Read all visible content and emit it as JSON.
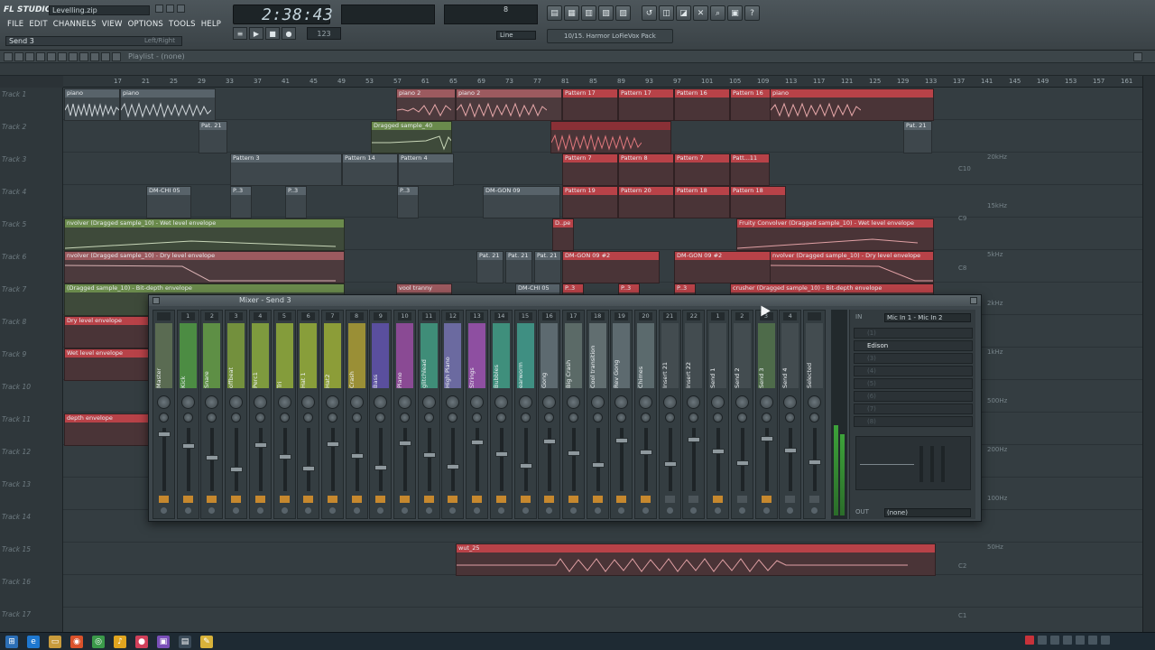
{
  "app": {
    "logo": "FL STUDIO",
    "filename": "Levelling.zip",
    "hint": "Send 3",
    "hint_right": "Left/Right"
  },
  "menu": [
    "FILE",
    "EDIT",
    "CHANNELS",
    "VIEW",
    "OPTIONS",
    "TOOLS",
    "HELP"
  ],
  "transport": {
    "time": "2:38:43",
    "play_icon": "play-icon",
    "stop_icon": "stop-icon",
    "record_icon": "record-icon",
    "cpu_value": "8",
    "line_mode": "Line"
  },
  "browser_preset": "10/15. Harmor LoFieVox Pack",
  "playlist": {
    "title": "Playlist - (none)",
    "ruler": [
      "17",
      "21",
      "25",
      "29",
      "33",
      "37",
      "41",
      "45",
      "49",
      "53",
      "57",
      "61",
      "65",
      "69",
      "73",
      "77",
      "81",
      "85",
      "89",
      "93",
      "97",
      "101",
      "105",
      "109",
      "113",
      "117",
      "121",
      "125",
      "129",
      "133",
      "137",
      "141",
      "145",
      "149",
      "153",
      "157",
      "161",
      "165"
    ],
    "tracks": [
      "Track 1",
      "Track 2",
      "Track 3",
      "Track 4",
      "Track 5",
      "Track 6",
      "Track 7",
      "Track 8",
      "Track 9",
      "Track 10",
      "Track 11",
      "Track 12",
      "Track 13",
      "Track 14",
      "Track 15",
      "Track 16",
      "Track 17"
    ],
    "piano_labels": [
      "C10",
      "C9",
      "C8",
      "C7",
      "C6",
      "C5",
      "C4",
      "C3",
      "C2",
      "C1"
    ],
    "freq_labels": [
      "20kHz",
      "15kHz",
      "5kHz",
      "2kHz",
      "1kHz",
      "500Hz",
      "200Hz",
      "100Hz",
      "50Hz"
    ],
    "clips": {
      "t1a": "piano",
      "t1b": "piano",
      "t1c": "piano 2",
      "t1d": "piano 2",
      "t1e": "Pattern 17",
      "t1f": "Pattern 17",
      "t1g": "Pattern 16",
      "t1h": "Pattern 16",
      "t1i": "piano",
      "t2a": "Pat. 21",
      "t2b": "Dragged sample_40",
      "t2c": "Pat. 21",
      "t3a": "Pattern 3",
      "t3b": "Pattern 14",
      "t3c": "Pattern 4",
      "t3d": "Pattern 7",
      "t3e": "Pattern 8",
      "t3f": "Pattern 7",
      "t3g": "Patt...11",
      "t4a": "DM-CHI 05",
      "t4b": "P..3",
      "t4c": "P..3",
      "t4d": "P..3",
      "t4e": "DM-GON 09",
      "t4f": "Pattern 19",
      "t4g": "Pattern 20",
      "t4h": "Pattern 18",
      "t4i": "Pattern 18",
      "t5a": "nvolver (Dragged sample_10) - Wet level envelope",
      "t5b": "D..pe",
      "t5c": "Fruity Convolver (Dragged sample_10) - Wet level envelope",
      "t6a": "nvolver (Dragged sample_10) - Dry level envelope",
      "t6b": "Pat. 21",
      "t6c": "Pat. 21",
      "t6d": "Pat. 21",
      "t6e": "DM-GON 09 #2",
      "t6f": "DM-GON 09 #2",
      "t6g": "nvolver (Dragged sample_10) - Dry level envelope",
      "t7a": "(Dragged sample_10) - Bit-depth envelope",
      "t7b": "vool tranny",
      "t7c": "DM-CHI 05",
      "t7d": "P..3",
      "t7e": "P..3",
      "t7f": "P..3",
      "t7g": "crusher (Dragged sample_10) - Bit-depth envelope",
      "t8a": "Dry level envelope",
      "t9a": "Wet level envelope",
      "t11a": "depth envelope",
      "t15a": "wut_25"
    }
  },
  "mixer": {
    "title": "Mixer - Send 3",
    "strips": [
      {
        "num": "",
        "name": "Master",
        "color": "#5a6b52"
      },
      {
        "num": "1",
        "name": "Kick",
        "color": "#4c8c43"
      },
      {
        "num": "2",
        "name": "Snare",
        "color": "#5e8f45"
      },
      {
        "num": "3",
        "name": "offbeat",
        "color": "#73903d"
      },
      {
        "num": "4",
        "name": "Perc1",
        "color": "#7e9a3e"
      },
      {
        "num": "5",
        "name": "Tri",
        "color": "#849c3b"
      },
      {
        "num": "6",
        "name": "Hat 1",
        "color": "#889e3a"
      },
      {
        "num": "7",
        "name": "Hat2",
        "color": "#8c9d38"
      },
      {
        "num": "8",
        "name": "Crash",
        "color": "#9a8f36"
      },
      {
        "num": "9",
        "name": "Bass",
        "color": "#5a4f9e"
      },
      {
        "num": "10",
        "name": "Piano",
        "color": "#8a4a94"
      },
      {
        "num": "11",
        "name": "glitchlead",
        "color": "#3f8d78"
      },
      {
        "num": "12",
        "name": "High Piano",
        "color": "#6b6aa0"
      },
      {
        "num": "13",
        "name": "Strings",
        "color": "#8e4fa1"
      },
      {
        "num": "14",
        "name": "Bubbles",
        "color": "#3f8f7c"
      },
      {
        "num": "15",
        "name": "earworm",
        "color": "#3f8f82"
      },
      {
        "num": "16",
        "name": "Gong",
        "color": "#5d6a70"
      },
      {
        "num": "17",
        "name": "Big Crash",
        "color": "#5b6a67"
      },
      {
        "num": "18",
        "name": "Cool transition",
        "color": "#616e70"
      },
      {
        "num": "19",
        "name": "Rev Gong",
        "color": "#5d6a6f"
      },
      {
        "num": "20",
        "name": "Chimes",
        "color": "#5b6a6d"
      },
      {
        "num": "21",
        "name": "Insert 21",
        "color": "#434c50"
      },
      {
        "num": "22",
        "name": "Insert 22",
        "color": "#434c50"
      },
      {
        "num": "1",
        "name": "Send 1",
        "color": "#434c50"
      },
      {
        "num": "2",
        "name": "Send 2",
        "color": "#434c50"
      },
      {
        "num": "3",
        "name": "Send 3",
        "color": "#4e6b4a"
      },
      {
        "num": "4",
        "name": "Send 4",
        "color": "#434c50"
      },
      {
        "num": "",
        "name": "Selected",
        "color": "#434c50"
      }
    ],
    "fx": {
      "in_label": "IN",
      "input": "Mic In 1 - Mic In 2",
      "slots": [
        "(1)",
        "Edison",
        "(3)",
        "(4)",
        "(5)",
        "(6)",
        "(7)",
        "(8)"
      ],
      "out_label": "OUT",
      "output": "(none)"
    }
  },
  "taskbar": [
    "start-icon",
    "ie-icon",
    "explorer-icon",
    "firefox-icon",
    "chrome-icon",
    "fl-icon",
    "app-icon",
    "app2-icon",
    "app3-icon",
    "notepad-icon"
  ]
}
